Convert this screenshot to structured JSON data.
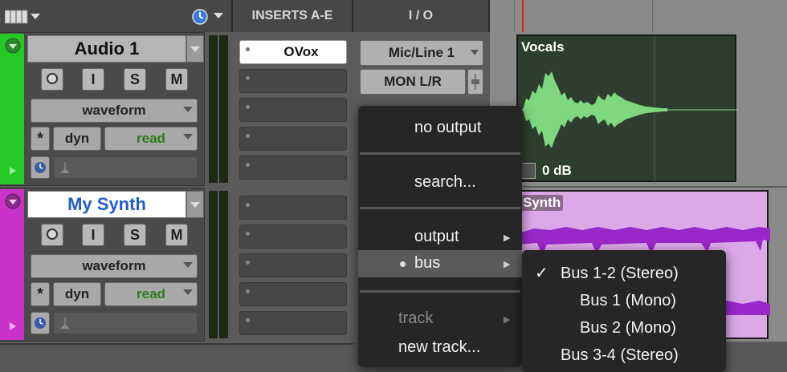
{
  "headers": {
    "inserts": "INSERTS A-E",
    "io": "I / O"
  },
  "tracks": [
    {
      "name": "Audio 1",
      "color": "#26c826",
      "record_label": "",
      "input_label": "I",
      "solo_label": "S",
      "mute_label": "M",
      "view": "waveform",
      "dyn_label": "dyn",
      "automation": "read",
      "insert_a": "OVox",
      "input": "Mic/Line 1",
      "output": "MON  L/R"
    },
    {
      "name": "My Synth",
      "color": "#c834c8",
      "record_label": "",
      "input_label": "I",
      "solo_label": "S",
      "mute_label": "M",
      "view": "waveform",
      "dyn_label": "dyn",
      "automation": "read"
    }
  ],
  "clips": {
    "vocals": "Vocals",
    "vocals_gain": "0 dB",
    "synth": "Synth"
  },
  "menu": {
    "no_output": "no output",
    "search": "search...",
    "output": "output",
    "bus": "bus",
    "track": "track",
    "new_track": "new track..."
  },
  "submenu": {
    "checkmark": "✓",
    "items": [
      "Bus 1-2 (Stereo)",
      "Bus 1 (Mono)",
      "Bus 2 (Mono)",
      "Bus 3-4 (Stereo)"
    ]
  }
}
